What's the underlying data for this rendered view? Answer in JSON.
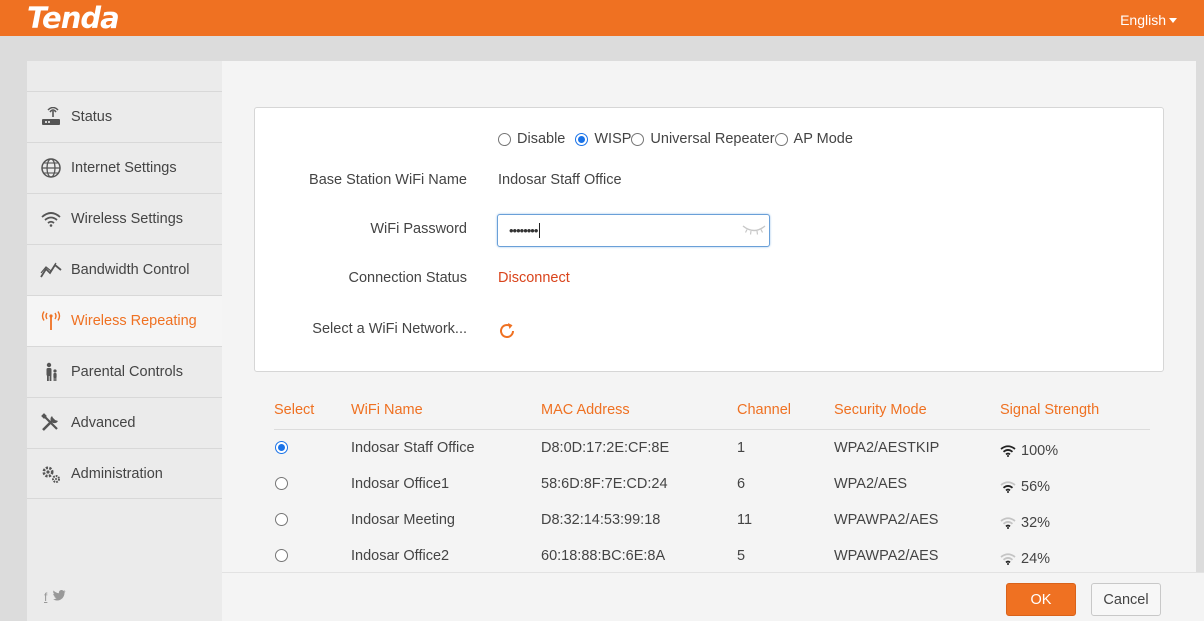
{
  "header": {
    "logo": "Tenda",
    "language": "English"
  },
  "colors": {
    "accent": "#ef7122",
    "status_red": "#d9441c",
    "radio_blue": "#1a73e8"
  },
  "sidebar": {
    "items": [
      {
        "label": "Status",
        "icon": "router-icon",
        "active": false
      },
      {
        "label": "Internet Settings",
        "icon": "globe-icon",
        "active": false
      },
      {
        "label": "Wireless Settings",
        "icon": "wifi-icon",
        "active": false
      },
      {
        "label": "Bandwidth Control",
        "icon": "bandwidth-chart-icon",
        "active": false
      },
      {
        "label": "Wireless Repeating",
        "icon": "antenna-icon",
        "active": true
      },
      {
        "label": "Parental Controls",
        "icon": "parent-child-icon",
        "active": false
      },
      {
        "label": "Advanced",
        "icon": "tools-icon",
        "active": false
      },
      {
        "label": "Administration",
        "icon": "gears-icon",
        "active": false
      }
    ],
    "social": [
      "f",
      "twitter"
    ]
  },
  "mode": {
    "options": [
      "Disable",
      "WISP",
      "Universal Repeater",
      "AP Mode"
    ],
    "selected": "WISP"
  },
  "form": {
    "base_station_label": "Base Station WiFi Name",
    "base_station_value": "Indosar Staff Office",
    "password_label": "WiFi Password",
    "password_value": "••••••••",
    "connection_label": "Connection Status",
    "connection_value": "Disconnect",
    "select_network_label": "Select a WiFi Network..."
  },
  "table": {
    "headers": [
      "Select",
      "WiFi Name",
      "MAC Address",
      "Channel",
      "Security Mode",
      "Signal Strength"
    ],
    "rows": [
      {
        "selected": true,
        "name": "Indosar Staff Office",
        "mac": "D8:0D:17:2E:CF:8E",
        "channel": "1",
        "security": "WPA2/AESTKIP",
        "signal": "100%",
        "bars": 3
      },
      {
        "selected": false,
        "name": "Indosar Office1",
        "mac": "58:6D:8F:7E:CD:24",
        "channel": "6",
        "security": "WPA2/AES",
        "signal": "56%",
        "bars": 2
      },
      {
        "selected": false,
        "name": "Indosar Meeting",
        "mac": "D8:32:14:53:99:18",
        "channel": "11",
        "security": "WPAWPA2/AES",
        "signal": "32%",
        "bars": 1
      },
      {
        "selected": false,
        "name": "Indosar Office2",
        "mac": "60:18:88:BC:6E:8A",
        "channel": "5",
        "security": "WPAWPA2/AES",
        "signal": "24%",
        "bars": 1
      }
    ]
  },
  "footer": {
    "ok_label": "OK",
    "cancel_label": "Cancel"
  }
}
